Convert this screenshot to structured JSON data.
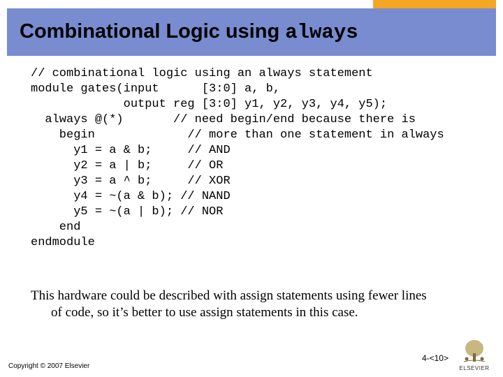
{
  "title": {
    "plain": "Combinational Logic using ",
    "keyword": "always"
  },
  "code": "// combinational logic using an always statement\nmodule gates(input      [3:0] a, b,\n             output reg [3:0] y1, y2, y3, y4, y5);\n  always @(*)       // need begin/end because there is\n    begin             // more than one statement in always\n      y1 = a & b;     // AND\n      y2 = a | b;     // OR\n      y3 = a ^ b;     // XOR\n      y4 = ~(a & b); // NAND\n      y5 = ~(a | b); // NOR\n    end\nendmodule",
  "note": "This hardware could be described with assign statements using fewer lines of code, so it’s better to use assign statements in this case.",
  "footer": {
    "copyright": "Copyright © 2007 Elsevier",
    "page": "4-<10>",
    "publisher": "ELSEVIER"
  }
}
